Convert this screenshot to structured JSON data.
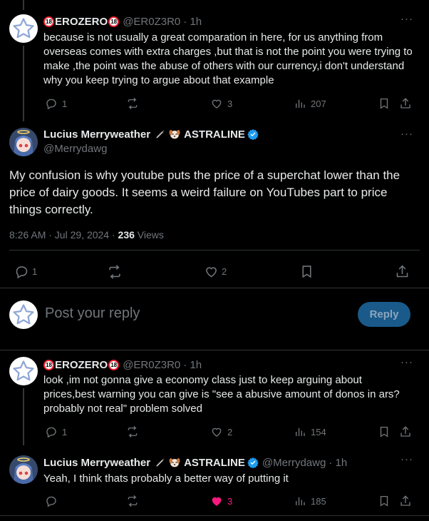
{
  "reply1": {
    "name": "EROZERO",
    "handle": "@ER0Z3R0",
    "time": "· 1h",
    "text": "because is not usually a great comparation in here, for us anything from overseas comes with extra charges ,but that is not the point you were trying to make ,the point was the abuse of others with our currency,i don't understand why you keep trying to argue about that example",
    "replies": "1",
    "likes": "3",
    "views": "207"
  },
  "main": {
    "name": "Lucius Merryweather",
    "name_suffix": "ASTRALINE",
    "handle": "@Merrydawg",
    "text": "My confusion is why youtube puts the price of a superchat lower than the price of dairy goods. It seems a weird failure on YouTubes part to price things correctly.",
    "timestamp": "8:26 AM · Jul 29, 2024 · ",
    "views_count": "236",
    "views_label": " Views",
    "replies": "1",
    "likes": "2"
  },
  "composer": {
    "placeholder": "Post your reply",
    "button": "Reply"
  },
  "reply2": {
    "name": "EROZERO",
    "handle": "@ER0Z3R0",
    "time": "· 1h",
    "text": "look ,im not gonna give a economy class just to keep arguing about prices,best warning you can give is \"see a abusive amount of donos in ars? probably not real\" problem solved",
    "replies": "1",
    "likes": "2",
    "views": "154"
  },
  "reply3": {
    "name": "Lucius Merryweather",
    "name_suffix": "ASTRALINE",
    "handle": "@Merrydawg",
    "time": "· 1h",
    "text": "Yeah, I think thats probably a better way of putting it",
    "likes": "3",
    "views": "185"
  },
  "badge": "18",
  "colors": {
    "accent": "#1d9bf0",
    "like_active": "#f91880",
    "reply_button_bg": "#1a5a8a"
  },
  "icons": [
    "reply-icon",
    "retweet-icon",
    "heart-icon",
    "views-icon",
    "bookmark-icon",
    "share-icon",
    "more-icon",
    "verified-icon",
    "pencil-icon",
    "dog-icon"
  ]
}
